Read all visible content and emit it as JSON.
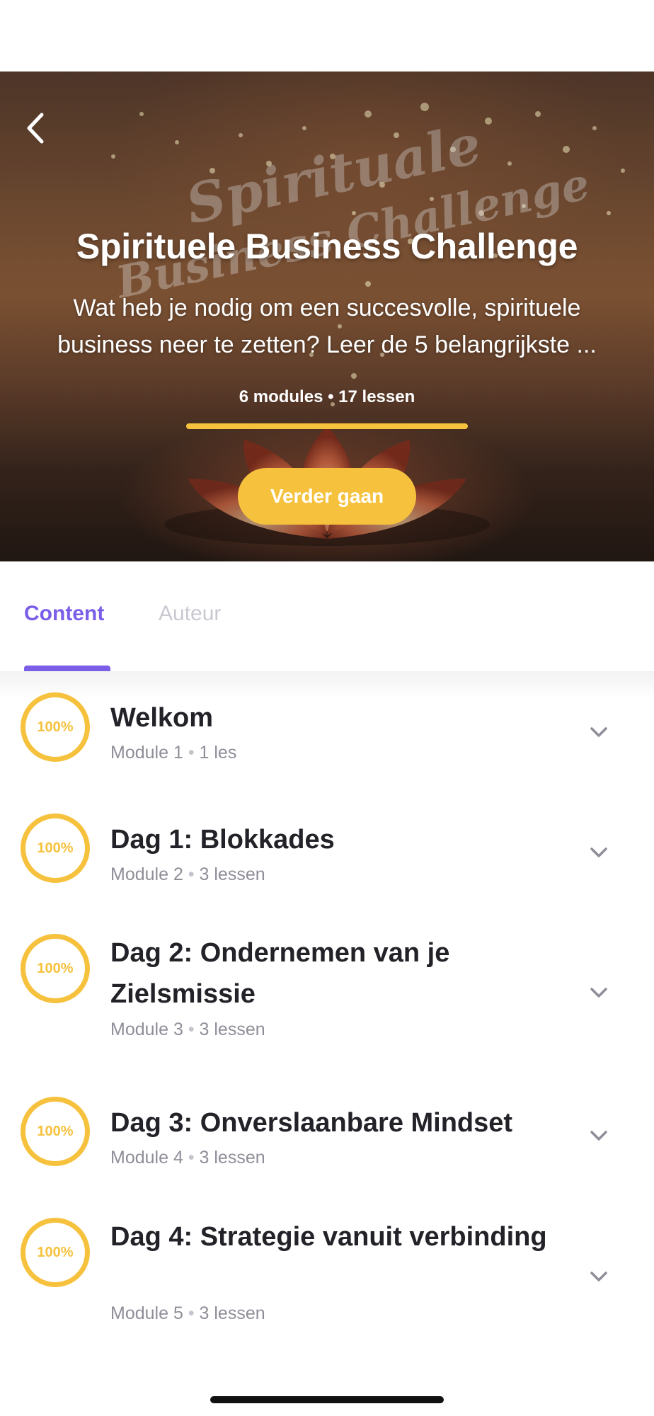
{
  "hero": {
    "title": "Spirituele Business Challenge",
    "description": "Wat heb je nodig om een succesvolle, spirituele business neer te zetten? Leer de 5 belangrijkste ...",
    "modules_count": "6 modules",
    "meta_separator": "•",
    "lessons_count": "17 lessen",
    "progress_fraction": 1.0,
    "cta_label": "Verder gaan",
    "image_watermark": "Spirituele Business Challenge"
  },
  "tabs": [
    {
      "label": "Content",
      "active": true
    },
    {
      "label": "Auteur",
      "active": false
    }
  ],
  "modules": [
    {
      "percent": "100%",
      "title": "Welkom",
      "module": "Module 1",
      "lessons": "1 les"
    },
    {
      "percent": "100%",
      "title": "Dag 1: Blokkades",
      "module": "Module 2",
      "lessons": "3 lessen"
    },
    {
      "percent": "100%",
      "title": "Dag 2: Ondernemen van je Zielsmissie",
      "module": "Module 3",
      "lessons": "3 lessen"
    },
    {
      "percent": "100%",
      "title": "Dag 3: Onverslaanbare Mindset",
      "module": "Module 4",
      "lessons": "3 lessen"
    },
    {
      "percent": "100%",
      "title": "Dag 4: Strategie vanuit verbinding",
      "module": "Module 5",
      "lessons": "3 lessen"
    }
  ],
  "separator": "•",
  "icons": {
    "back": "chevron-left-icon",
    "expand": "chevron-down-icon"
  },
  "colors": {
    "accent_yellow": "#f6c23e",
    "accent_purple": "#7b5ee8",
    "text_dark": "#222228",
    "text_muted": "#8e8e98"
  }
}
